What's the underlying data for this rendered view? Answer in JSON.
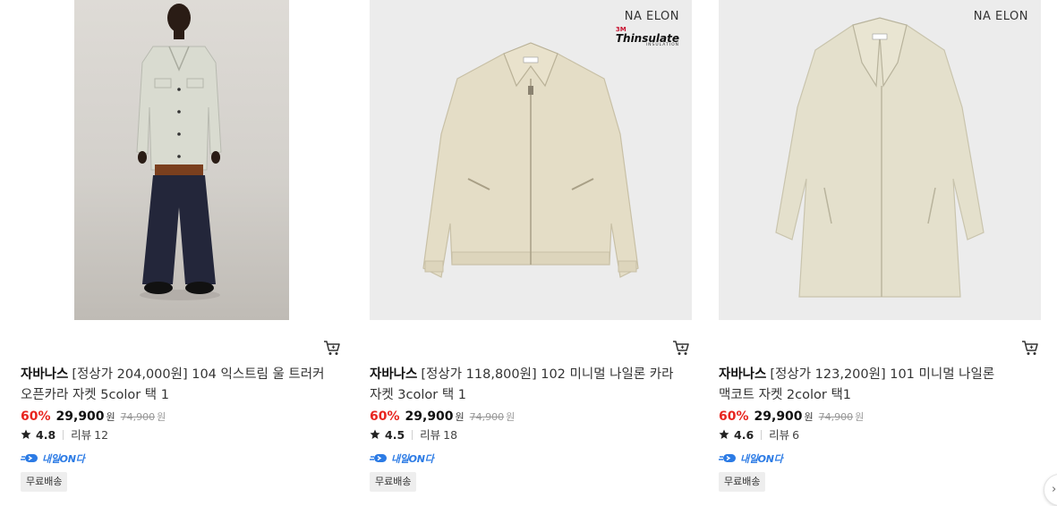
{
  "products": [
    {
      "image_alt": "olive-open-collar-jacket-model-photo",
      "brand_label": "",
      "seller": "자바나스",
      "name": "[정상가 204,000원] 104 익스트림 울 트러커 오픈카라 자켓 5color 택 1",
      "discount_rate": "60%",
      "price": "29,900",
      "currency": "원",
      "original_price": "74,900",
      "original_currency": "원",
      "rating": "4.8",
      "review_label": "리뷰",
      "review_count": "12",
      "delivery_label": "내일ON다",
      "badge": "무료배송"
    },
    {
      "image_alt": "beige-nylon-collar-jacket",
      "brand_label": "NA ELON",
      "thinsulate_3m": "3M",
      "thinsulate_name": "Thinsulate",
      "thinsulate_sub": "INSULATION",
      "seller": "자바나스",
      "name": "[정상가 118,800원] 102 미니멀 나일론 카라 자켓 3color 택 1",
      "discount_rate": "60%",
      "price": "29,900",
      "currency": "원",
      "original_price": "74,900",
      "original_currency": "원",
      "rating": "4.5",
      "review_label": "리뷰",
      "review_count": "18",
      "delivery_label": "내일ON다",
      "badge": "무료배송"
    },
    {
      "image_alt": "beige-nylon-mac-coat",
      "brand_label": "NA ELON",
      "seller": "자바나스",
      "name": "[정상가 123,200원] 101 미니멀 나일론 맥코트 자켓 2color 택1",
      "discount_rate": "60%",
      "price": "29,900",
      "currency": "원",
      "original_price": "74,900",
      "original_currency": "원",
      "rating": "4.6",
      "review_label": "리뷰",
      "review_count": "6",
      "delivery_label": "내일ON다",
      "badge": "무료배송"
    }
  ],
  "colors": {
    "discount": "#e8251f",
    "delivery": "#2c7be5",
    "badge_bg": "#eeeeee"
  },
  "icons": {
    "cart": "cart-icon",
    "star": "star-icon",
    "delivery": "delivery-truck-icon",
    "next": "chevron-right-icon"
  }
}
